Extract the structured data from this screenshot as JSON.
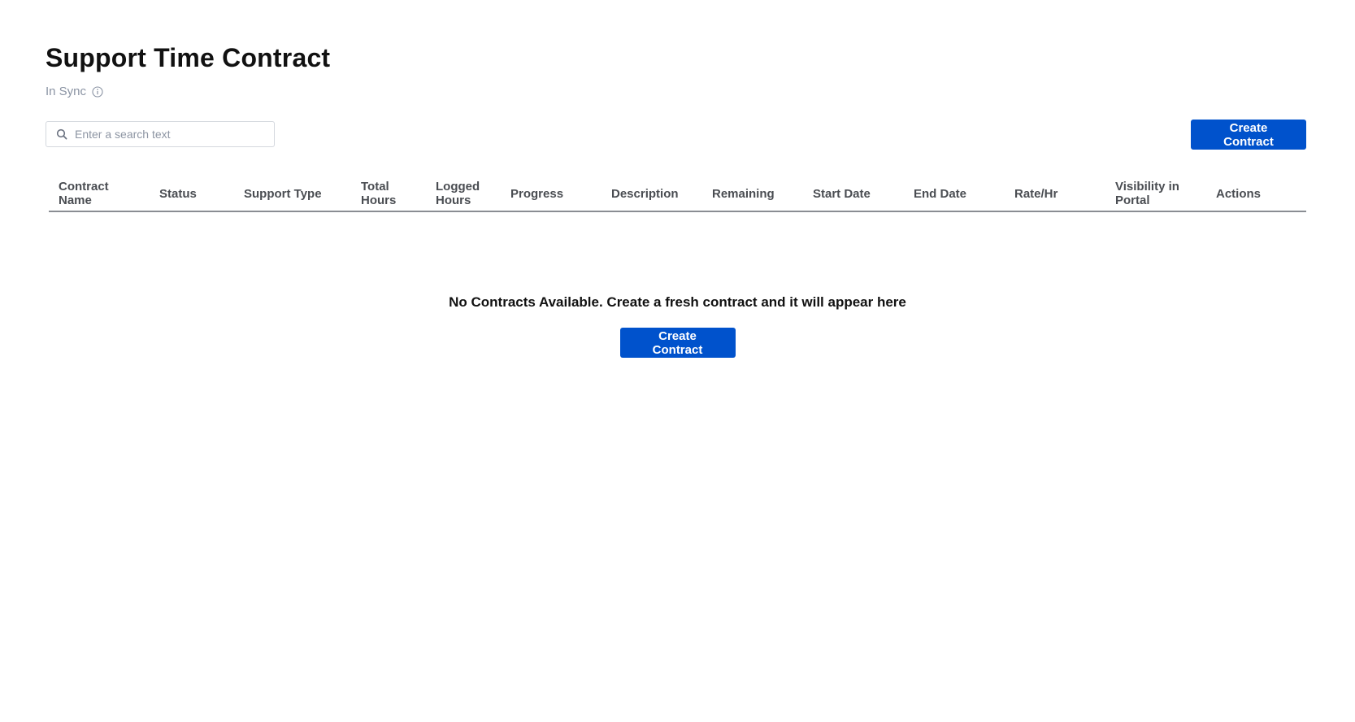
{
  "page": {
    "title": "Support Time Contract",
    "sync_status": "In Sync"
  },
  "search": {
    "placeholder": "Enter a search text",
    "value": ""
  },
  "toolbar": {
    "create_label": "Create Contract"
  },
  "table": {
    "columns": [
      "Contract Name",
      "Status",
      "Support Type",
      "Total Hours",
      "Logged Hours",
      "Progress",
      "Description",
      "Remaining",
      "Start Date",
      "End Date",
      "Rate/Hr",
      "Visibility in Portal",
      "Actions"
    ],
    "rows": []
  },
  "empty_state": {
    "message": "No Contracts Available. Create a fresh contract and it will appear here",
    "create_label": "Create Contract"
  },
  "icons": {
    "info": "info-icon",
    "search": "search-icon"
  },
  "colors": {
    "primary": "#0052cc",
    "muted_text": "#8a93a3",
    "header_text": "#4a4d52"
  }
}
